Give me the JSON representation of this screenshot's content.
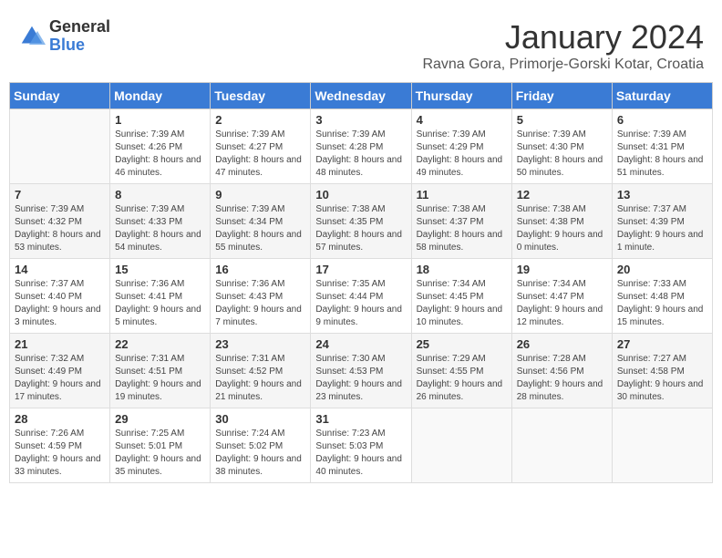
{
  "header": {
    "logo_general": "General",
    "logo_blue": "Blue",
    "month_title": "January 2024",
    "location": "Ravna Gora, Primorje-Gorski Kotar, Croatia"
  },
  "weekdays": [
    "Sunday",
    "Monday",
    "Tuesday",
    "Wednesday",
    "Thursday",
    "Friday",
    "Saturday"
  ],
  "weeks": [
    [
      {
        "day": "",
        "sunrise": "",
        "sunset": "",
        "daylight": ""
      },
      {
        "day": "1",
        "sunrise": "Sunrise: 7:39 AM",
        "sunset": "Sunset: 4:26 PM",
        "daylight": "Daylight: 8 hours and 46 minutes."
      },
      {
        "day": "2",
        "sunrise": "Sunrise: 7:39 AM",
        "sunset": "Sunset: 4:27 PM",
        "daylight": "Daylight: 8 hours and 47 minutes."
      },
      {
        "day": "3",
        "sunrise": "Sunrise: 7:39 AM",
        "sunset": "Sunset: 4:28 PM",
        "daylight": "Daylight: 8 hours and 48 minutes."
      },
      {
        "day": "4",
        "sunrise": "Sunrise: 7:39 AM",
        "sunset": "Sunset: 4:29 PM",
        "daylight": "Daylight: 8 hours and 49 minutes."
      },
      {
        "day": "5",
        "sunrise": "Sunrise: 7:39 AM",
        "sunset": "Sunset: 4:30 PM",
        "daylight": "Daylight: 8 hours and 50 minutes."
      },
      {
        "day": "6",
        "sunrise": "Sunrise: 7:39 AM",
        "sunset": "Sunset: 4:31 PM",
        "daylight": "Daylight: 8 hours and 51 minutes."
      }
    ],
    [
      {
        "day": "7",
        "sunrise": "Sunrise: 7:39 AM",
        "sunset": "Sunset: 4:32 PM",
        "daylight": "Daylight: 8 hours and 53 minutes."
      },
      {
        "day": "8",
        "sunrise": "Sunrise: 7:39 AM",
        "sunset": "Sunset: 4:33 PM",
        "daylight": "Daylight: 8 hours and 54 minutes."
      },
      {
        "day": "9",
        "sunrise": "Sunrise: 7:39 AM",
        "sunset": "Sunset: 4:34 PM",
        "daylight": "Daylight: 8 hours and 55 minutes."
      },
      {
        "day": "10",
        "sunrise": "Sunrise: 7:38 AM",
        "sunset": "Sunset: 4:35 PM",
        "daylight": "Daylight: 8 hours and 57 minutes."
      },
      {
        "day": "11",
        "sunrise": "Sunrise: 7:38 AM",
        "sunset": "Sunset: 4:37 PM",
        "daylight": "Daylight: 8 hours and 58 minutes."
      },
      {
        "day": "12",
        "sunrise": "Sunrise: 7:38 AM",
        "sunset": "Sunset: 4:38 PM",
        "daylight": "Daylight: 9 hours and 0 minutes."
      },
      {
        "day": "13",
        "sunrise": "Sunrise: 7:37 AM",
        "sunset": "Sunset: 4:39 PM",
        "daylight": "Daylight: 9 hours and 1 minute."
      }
    ],
    [
      {
        "day": "14",
        "sunrise": "Sunrise: 7:37 AM",
        "sunset": "Sunset: 4:40 PM",
        "daylight": "Daylight: 9 hours and 3 minutes."
      },
      {
        "day": "15",
        "sunrise": "Sunrise: 7:36 AM",
        "sunset": "Sunset: 4:41 PM",
        "daylight": "Daylight: 9 hours and 5 minutes."
      },
      {
        "day": "16",
        "sunrise": "Sunrise: 7:36 AM",
        "sunset": "Sunset: 4:43 PM",
        "daylight": "Daylight: 9 hours and 7 minutes."
      },
      {
        "day": "17",
        "sunrise": "Sunrise: 7:35 AM",
        "sunset": "Sunset: 4:44 PM",
        "daylight": "Daylight: 9 hours and 9 minutes."
      },
      {
        "day": "18",
        "sunrise": "Sunrise: 7:34 AM",
        "sunset": "Sunset: 4:45 PM",
        "daylight": "Daylight: 9 hours and 10 minutes."
      },
      {
        "day": "19",
        "sunrise": "Sunrise: 7:34 AM",
        "sunset": "Sunset: 4:47 PM",
        "daylight": "Daylight: 9 hours and 12 minutes."
      },
      {
        "day": "20",
        "sunrise": "Sunrise: 7:33 AM",
        "sunset": "Sunset: 4:48 PM",
        "daylight": "Daylight: 9 hours and 15 minutes."
      }
    ],
    [
      {
        "day": "21",
        "sunrise": "Sunrise: 7:32 AM",
        "sunset": "Sunset: 4:49 PM",
        "daylight": "Daylight: 9 hours and 17 minutes."
      },
      {
        "day": "22",
        "sunrise": "Sunrise: 7:31 AM",
        "sunset": "Sunset: 4:51 PM",
        "daylight": "Daylight: 9 hours and 19 minutes."
      },
      {
        "day": "23",
        "sunrise": "Sunrise: 7:31 AM",
        "sunset": "Sunset: 4:52 PM",
        "daylight": "Daylight: 9 hours and 21 minutes."
      },
      {
        "day": "24",
        "sunrise": "Sunrise: 7:30 AM",
        "sunset": "Sunset: 4:53 PM",
        "daylight": "Daylight: 9 hours and 23 minutes."
      },
      {
        "day": "25",
        "sunrise": "Sunrise: 7:29 AM",
        "sunset": "Sunset: 4:55 PM",
        "daylight": "Daylight: 9 hours and 26 minutes."
      },
      {
        "day": "26",
        "sunrise": "Sunrise: 7:28 AM",
        "sunset": "Sunset: 4:56 PM",
        "daylight": "Daylight: 9 hours and 28 minutes."
      },
      {
        "day": "27",
        "sunrise": "Sunrise: 7:27 AM",
        "sunset": "Sunset: 4:58 PM",
        "daylight": "Daylight: 9 hours and 30 minutes."
      }
    ],
    [
      {
        "day": "28",
        "sunrise": "Sunrise: 7:26 AM",
        "sunset": "Sunset: 4:59 PM",
        "daylight": "Daylight: 9 hours and 33 minutes."
      },
      {
        "day": "29",
        "sunrise": "Sunrise: 7:25 AM",
        "sunset": "Sunset: 5:01 PM",
        "daylight": "Daylight: 9 hours and 35 minutes."
      },
      {
        "day": "30",
        "sunrise": "Sunrise: 7:24 AM",
        "sunset": "Sunset: 5:02 PM",
        "daylight": "Daylight: 9 hours and 38 minutes."
      },
      {
        "day": "31",
        "sunrise": "Sunrise: 7:23 AM",
        "sunset": "Sunset: 5:03 PM",
        "daylight": "Daylight: 9 hours and 40 minutes."
      },
      {
        "day": "",
        "sunrise": "",
        "sunset": "",
        "daylight": ""
      },
      {
        "day": "",
        "sunrise": "",
        "sunset": "",
        "daylight": ""
      },
      {
        "day": "",
        "sunrise": "",
        "sunset": "",
        "daylight": ""
      }
    ]
  ]
}
